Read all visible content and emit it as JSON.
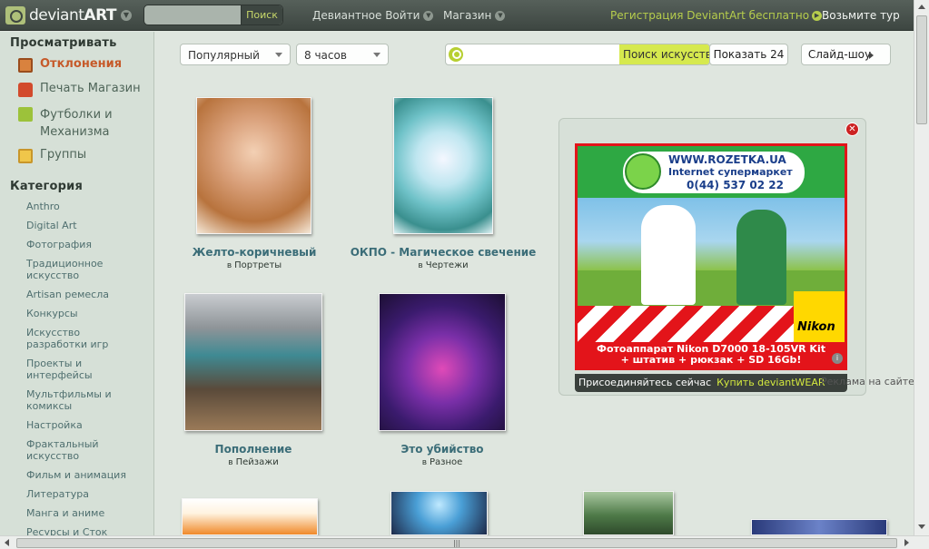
{
  "header": {
    "logo_text": "deviant",
    "logo_text_bold": "ART",
    "search_placeholder": "",
    "search_button": "Поиск",
    "nav_deviant": "Девиантное Войти",
    "nav_shop": "Магазин",
    "register": "Регистрация DeviantArt бесплатно",
    "tour": "Возьмите тур"
  },
  "sidebar": {
    "browse_heading": "Просматривать",
    "main_items": [
      {
        "label": "Отклонения",
        "icon": "deviation-icon"
      },
      {
        "label": "Печать Магазин",
        "icon": "shop-bag-icon"
      },
      {
        "label": "Футболки и",
        "label2": "Механизма",
        "icon": "tshirt-icon"
      },
      {
        "label": "Группы",
        "icon": "house-icon"
      }
    ],
    "category_heading": "Категория",
    "categories": [
      {
        "l1": "Anthro"
      },
      {
        "l1": "Digital Art"
      },
      {
        "l1": "Фотография"
      },
      {
        "l1": "Традиционное",
        "l2": "искусство"
      },
      {
        "l1": "Artisan ремесла"
      },
      {
        "l1": "Конкурсы"
      },
      {
        "l1": "Искусство",
        "l2": "разработки игр"
      },
      {
        "l1": "Проекты и",
        "l2": "интерфейсы"
      },
      {
        "l1": "Мультфильмы и",
        "l2": "комиксы"
      },
      {
        "l1": "Настройка"
      },
      {
        "l1": "Фрактальный",
        "l2": "искусство"
      },
      {
        "l1": "Фильм и анимация"
      },
      {
        "l1": "Литература"
      },
      {
        "l1": "Манга и аниме"
      },
      {
        "l1": "Ресурсы и Сток"
      }
    ]
  },
  "toolbar": {
    "sort": "Популярный",
    "period": "8 часов",
    "search_placeholder": "",
    "search_button": "Поиск искусства",
    "show": "Показать 24",
    "slideshow": "Слайд-шоу"
  },
  "gallery": [
    {
      "title": "Желто-коричневый",
      "in": "в",
      "category": "Портреты"
    },
    {
      "title": "ОКПО - Магическое свечение",
      "in": "в",
      "category": "Чертежи"
    },
    {
      "title": "Пополнение",
      "in": "в",
      "category": "Пейзажи"
    },
    {
      "title": "Это убийство",
      "in": "в",
      "category": "Разное"
    }
  ],
  "ad": {
    "site": "WWW.ROZETKA.UA",
    "tagline": "Internet супермаркет",
    "phone": "0(44) 537 02 22",
    "brand": "Nikon",
    "offer_line1": "Фотоаппарат Nikon D7000 18-105VR Kit",
    "offer_line2": "+ штатив + рюкзак + SD 16Gb!",
    "join": "Присоединяйтесь сейчас",
    "buy": "Купить deviantWEAR",
    "report": "Реклама на сайте"
  },
  "colors": {
    "accent_green": "#b6cd4c",
    "active_orange": "#c65a2a",
    "link_teal": "#3b6d78"
  }
}
